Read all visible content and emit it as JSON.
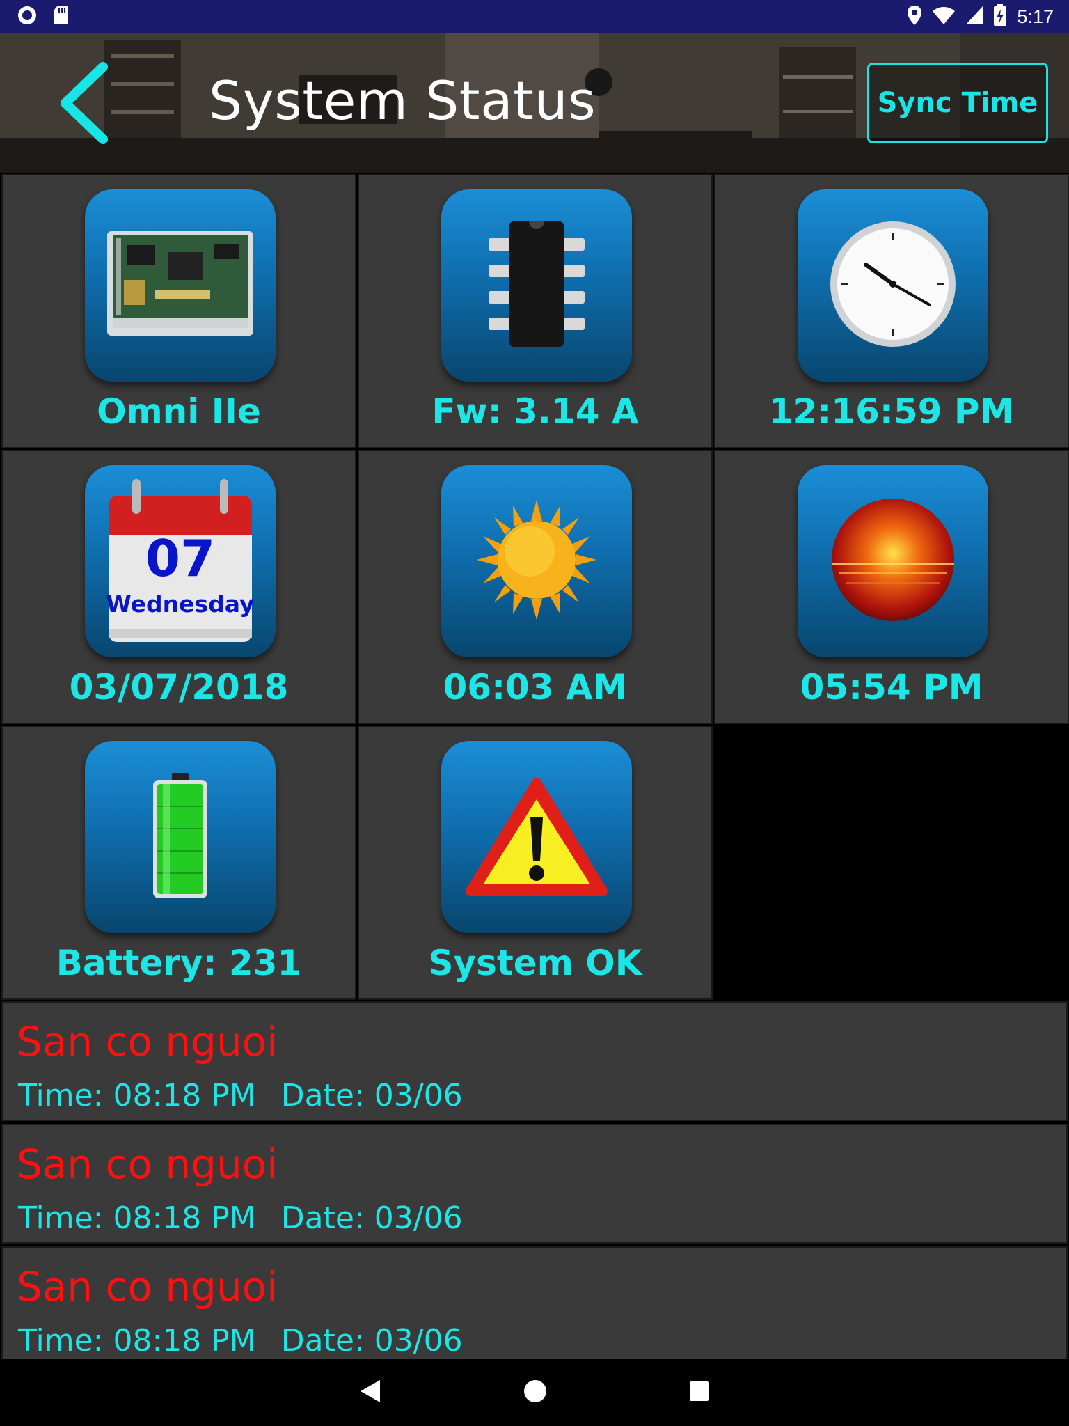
{
  "status_bar": {
    "time": "5:17",
    "icons": [
      "record-icon",
      "sd-card-icon",
      "location-icon",
      "wifi-icon",
      "signal-icon",
      "battery-charging-icon"
    ]
  },
  "header": {
    "title": "System Status",
    "back_icon": "chevron-left-icon",
    "sync_label": "Sync Time"
  },
  "tiles": [
    {
      "label": "Omni IIe",
      "icon": "circuit-board-icon"
    },
    {
      "label": "Fw: 3.14 A",
      "icon": "chip-icon"
    },
    {
      "label": "12:16:59 PM",
      "icon": "clock-icon"
    },
    {
      "label": "03/07/2018",
      "icon": "calendar-icon",
      "calendar_day": "07",
      "calendar_weekday": "Wednesday"
    },
    {
      "label": "06:03 AM",
      "icon": "sun-icon"
    },
    {
      "label": "05:54 PM",
      "icon": "sunset-icon"
    },
    {
      "label": "Battery:  231",
      "icon": "battery-icon"
    },
    {
      "label": "System OK",
      "icon": "warning-icon"
    }
  ],
  "events": [
    {
      "title": "San co nguoi",
      "time": "Time: 08:18 PM",
      "date": "Date: 03/06"
    },
    {
      "title": "San co nguoi",
      "time": "Time: 08:18 PM",
      "date": "Date: 03/06"
    },
    {
      "title": "San co nguoi",
      "time": "Time: 08:18 PM",
      "date": "Date: 03/06"
    }
  ],
  "nav_bar": {
    "icons": [
      "back-triangle-icon",
      "home-circle-icon",
      "recents-square-icon"
    ]
  },
  "colors": {
    "accent": "#1de6e6",
    "event_title": "#ff1010",
    "tile_bg": "#3a3a3a",
    "status_bar": "#1a1a6e"
  }
}
